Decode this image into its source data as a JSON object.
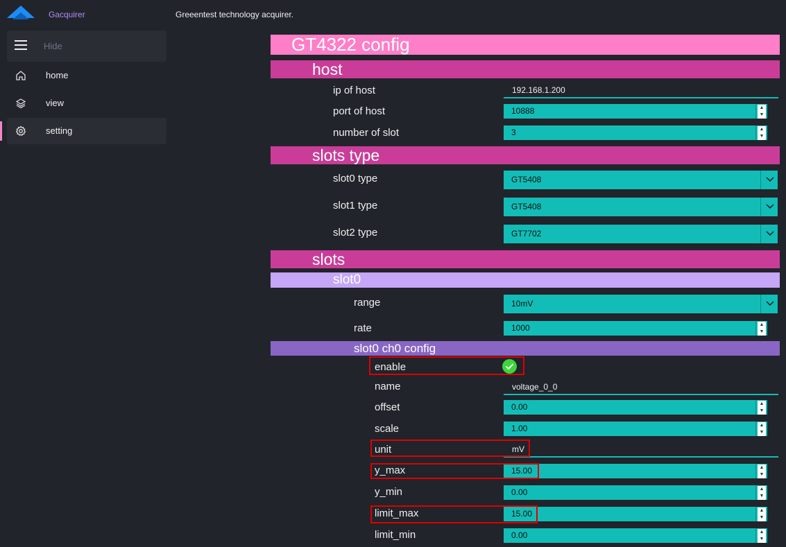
{
  "app": {
    "name": "Gacquirer",
    "subtitle": "Greeentest technology acquirer."
  },
  "sidebar": {
    "hide_label": "Hide",
    "items": [
      {
        "label": "home",
        "icon": "home-icon"
      },
      {
        "label": "view",
        "icon": "layers-icon"
      },
      {
        "label": "setting",
        "icon": "gear-icon",
        "active": true
      }
    ]
  },
  "config": {
    "title": "GT4322 config",
    "host": {
      "header": "host",
      "ip_label": "ip of host",
      "ip_value": "192.168.1.200",
      "port_label": "port of host",
      "port_value": "10888",
      "slots_label": "number of slot",
      "slots_value": "3"
    },
    "slots_type": {
      "header": "slots type",
      "items": [
        {
          "label": "slot0 type",
          "value": "GT5408"
        },
        {
          "label": "slot1 type",
          "value": "GT5408"
        },
        {
          "label": "slot2 type",
          "value": "GT7702"
        }
      ]
    },
    "slots": {
      "header": "slots",
      "slot0": {
        "header": "slot0",
        "range_label": "range",
        "range_value": "10mV",
        "rate_label": "rate",
        "rate_value": "1000",
        "ch0": {
          "header": "slot0 ch0 config",
          "enable_label": "enable",
          "enabled": true,
          "name_label": "name",
          "name_value": "voltage_0_0",
          "offset_label": "offset",
          "offset_value": "0.00",
          "scale_label": "scale",
          "scale_value": "1.00",
          "unit_label": "unit",
          "unit_value": "mV",
          "ymax_label": "y_max",
          "ymax_value": "15.00",
          "ymin_label": "y_min",
          "ymin_value": "0.00",
          "limitmax_label": "limit_max",
          "limitmax_value": "15.00",
          "limitmin_label": "limit_min",
          "limitmin_value": "0.00"
        }
      }
    }
  },
  "colors": {
    "band_top": "#ff7ec8",
    "band_section": "#c93d98",
    "band_slot": "#c6a6f7",
    "band_channel": "#8966c4",
    "field": "#12bdb7",
    "highlight": "#e00000"
  }
}
